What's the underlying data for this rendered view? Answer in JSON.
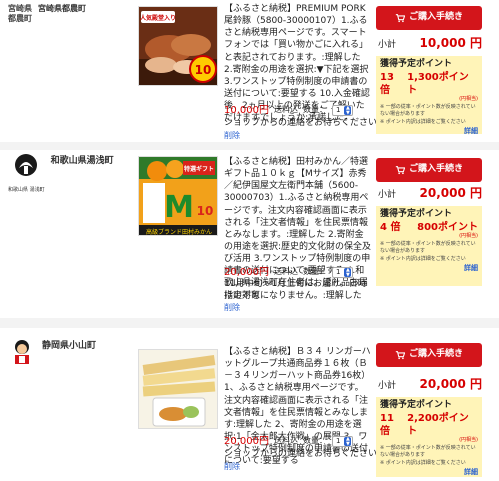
{
  "items": [
    {
      "municipality": "宮崎県都農町",
      "logo_text": "宮崎県\n都農町",
      "description": "【ふるさと納税】PREMIUM PORK尾鈴豚（5800-30000107）1.ふるさと納税専用ページです。スマートフォンでは「買い物かごに入れる」と表記されております。:理解した 2.寄附金の用途を選択:▼下記を選択 3.ワンストップ特例制度の申請書の送付について:要望する 10.入金確認後、2ヵ月以上の発送をご了解いただけますでしょうか:承諾した。",
      "price": "10,000円",
      "shipping": "送料込",
      "qty_label": "数量：",
      "qty": "1",
      "contact": "ショップからの連絡をお待ちください",
      "delete": "削除",
      "buy_label": "ご購入手続き",
      "subtotal_label": "小計",
      "subtotal": "10,000 円",
      "points_title": "獲得予定ポイント",
      "points_rate": "13 倍",
      "points_value": "1,300ポイント",
      "points_sub": "(円相当)",
      "points_note1": "※ 一部の従率・ポイント数が反映されていない場合があります",
      "points_note2": "※ ポイント内訳は詳細をご覧ください",
      "detail": "詳細",
      "thumb_badge": "人気殿堂入り",
      "thumb_number": "10"
    },
    {
      "municipality": "和歌山県湯浅町",
      "logo_caption": "和歌山県 湯浅町",
      "description": "【ふるさと納税】田村みかん／特選ギフト品１０ｋｇ【Mサイズ】赤秀／紀伊国屋文左衛門本舗（5600-30000703）1.ふるさと納税専用ページです。注文内容確認画面に表示される「注文者情報」を住民票情報とみなします。:理解した 2.寄附金の用途を選択:歴史的文化財の保全及び活用 3.ワンストップ特例制度の申請書の送付について:要望する 4.和歌山県湯浅町在住者は、返礼品お届けの対象になりません。:理解した",
      "price": "20,000円",
      "shipping": "送料込",
      "qty_label": "数量：",
      "qty": "1",
      "contact": "11月中旬〜1月上旬にお届け。日時指定不可",
      "delete": "削除",
      "buy_label": "ご購入手続き",
      "subtotal_label": "小計",
      "subtotal": "20,000 円",
      "points_title": "獲得予定ポイント",
      "points_rate": "4 倍",
      "points_value": "800ポイント",
      "points_sub": "(円相当)",
      "points_note1": "※ 一部の従率・ポイント数が反映されていない場合があります",
      "points_note2": "※ ポイント内訳は詳細をご覧ください",
      "detail": "詳細",
      "thumb_label_top": "特選ギフト",
      "thumb_size": "M",
      "thumb_number": "10",
      "thumb_brand": "高級ブランド田村みかん"
    },
    {
      "municipality": "静岡県小山町",
      "description": "【ふるさと納税】Ｂ３４ リンガーハットグループ共通商品券１６枚（Ｂ－３４リンガーハット商品券16枚）1、ふるさと納税専用ページです。注文内容確認画面に表示される「注文者情報」を住民票情報とみなします:理解した 2、寄附金の用途を選択:1「金太郎大作戦」の展開 3、ワンストップ特例制度の申請書の送付について:要望する",
      "price": "20,000円",
      "shipping": "送料込",
      "qty_label": "数量：",
      "qty": "1",
      "contact": "ショップからの連絡をお待ちください",
      "delete": "削除",
      "buy_label": "ご購入手続き",
      "subtotal_label": "小計",
      "subtotal": "20,000 円",
      "points_title": "獲得予定ポイント",
      "points_rate": "11 倍",
      "points_value": "2,200ポイント",
      "points_sub": "(円相当)",
      "points_note1": "※ 一部の従率・ポイント数が反映されていない場合があります",
      "points_note2": "※ ポイント内訳は詳細をご覧ください",
      "detail": "詳細"
    }
  ],
  "colors": {
    "accent_red": "#d3151b",
    "price_red": "#d60000",
    "link_blue": "#2b62d0",
    "points_bg": "#fff4b8"
  }
}
